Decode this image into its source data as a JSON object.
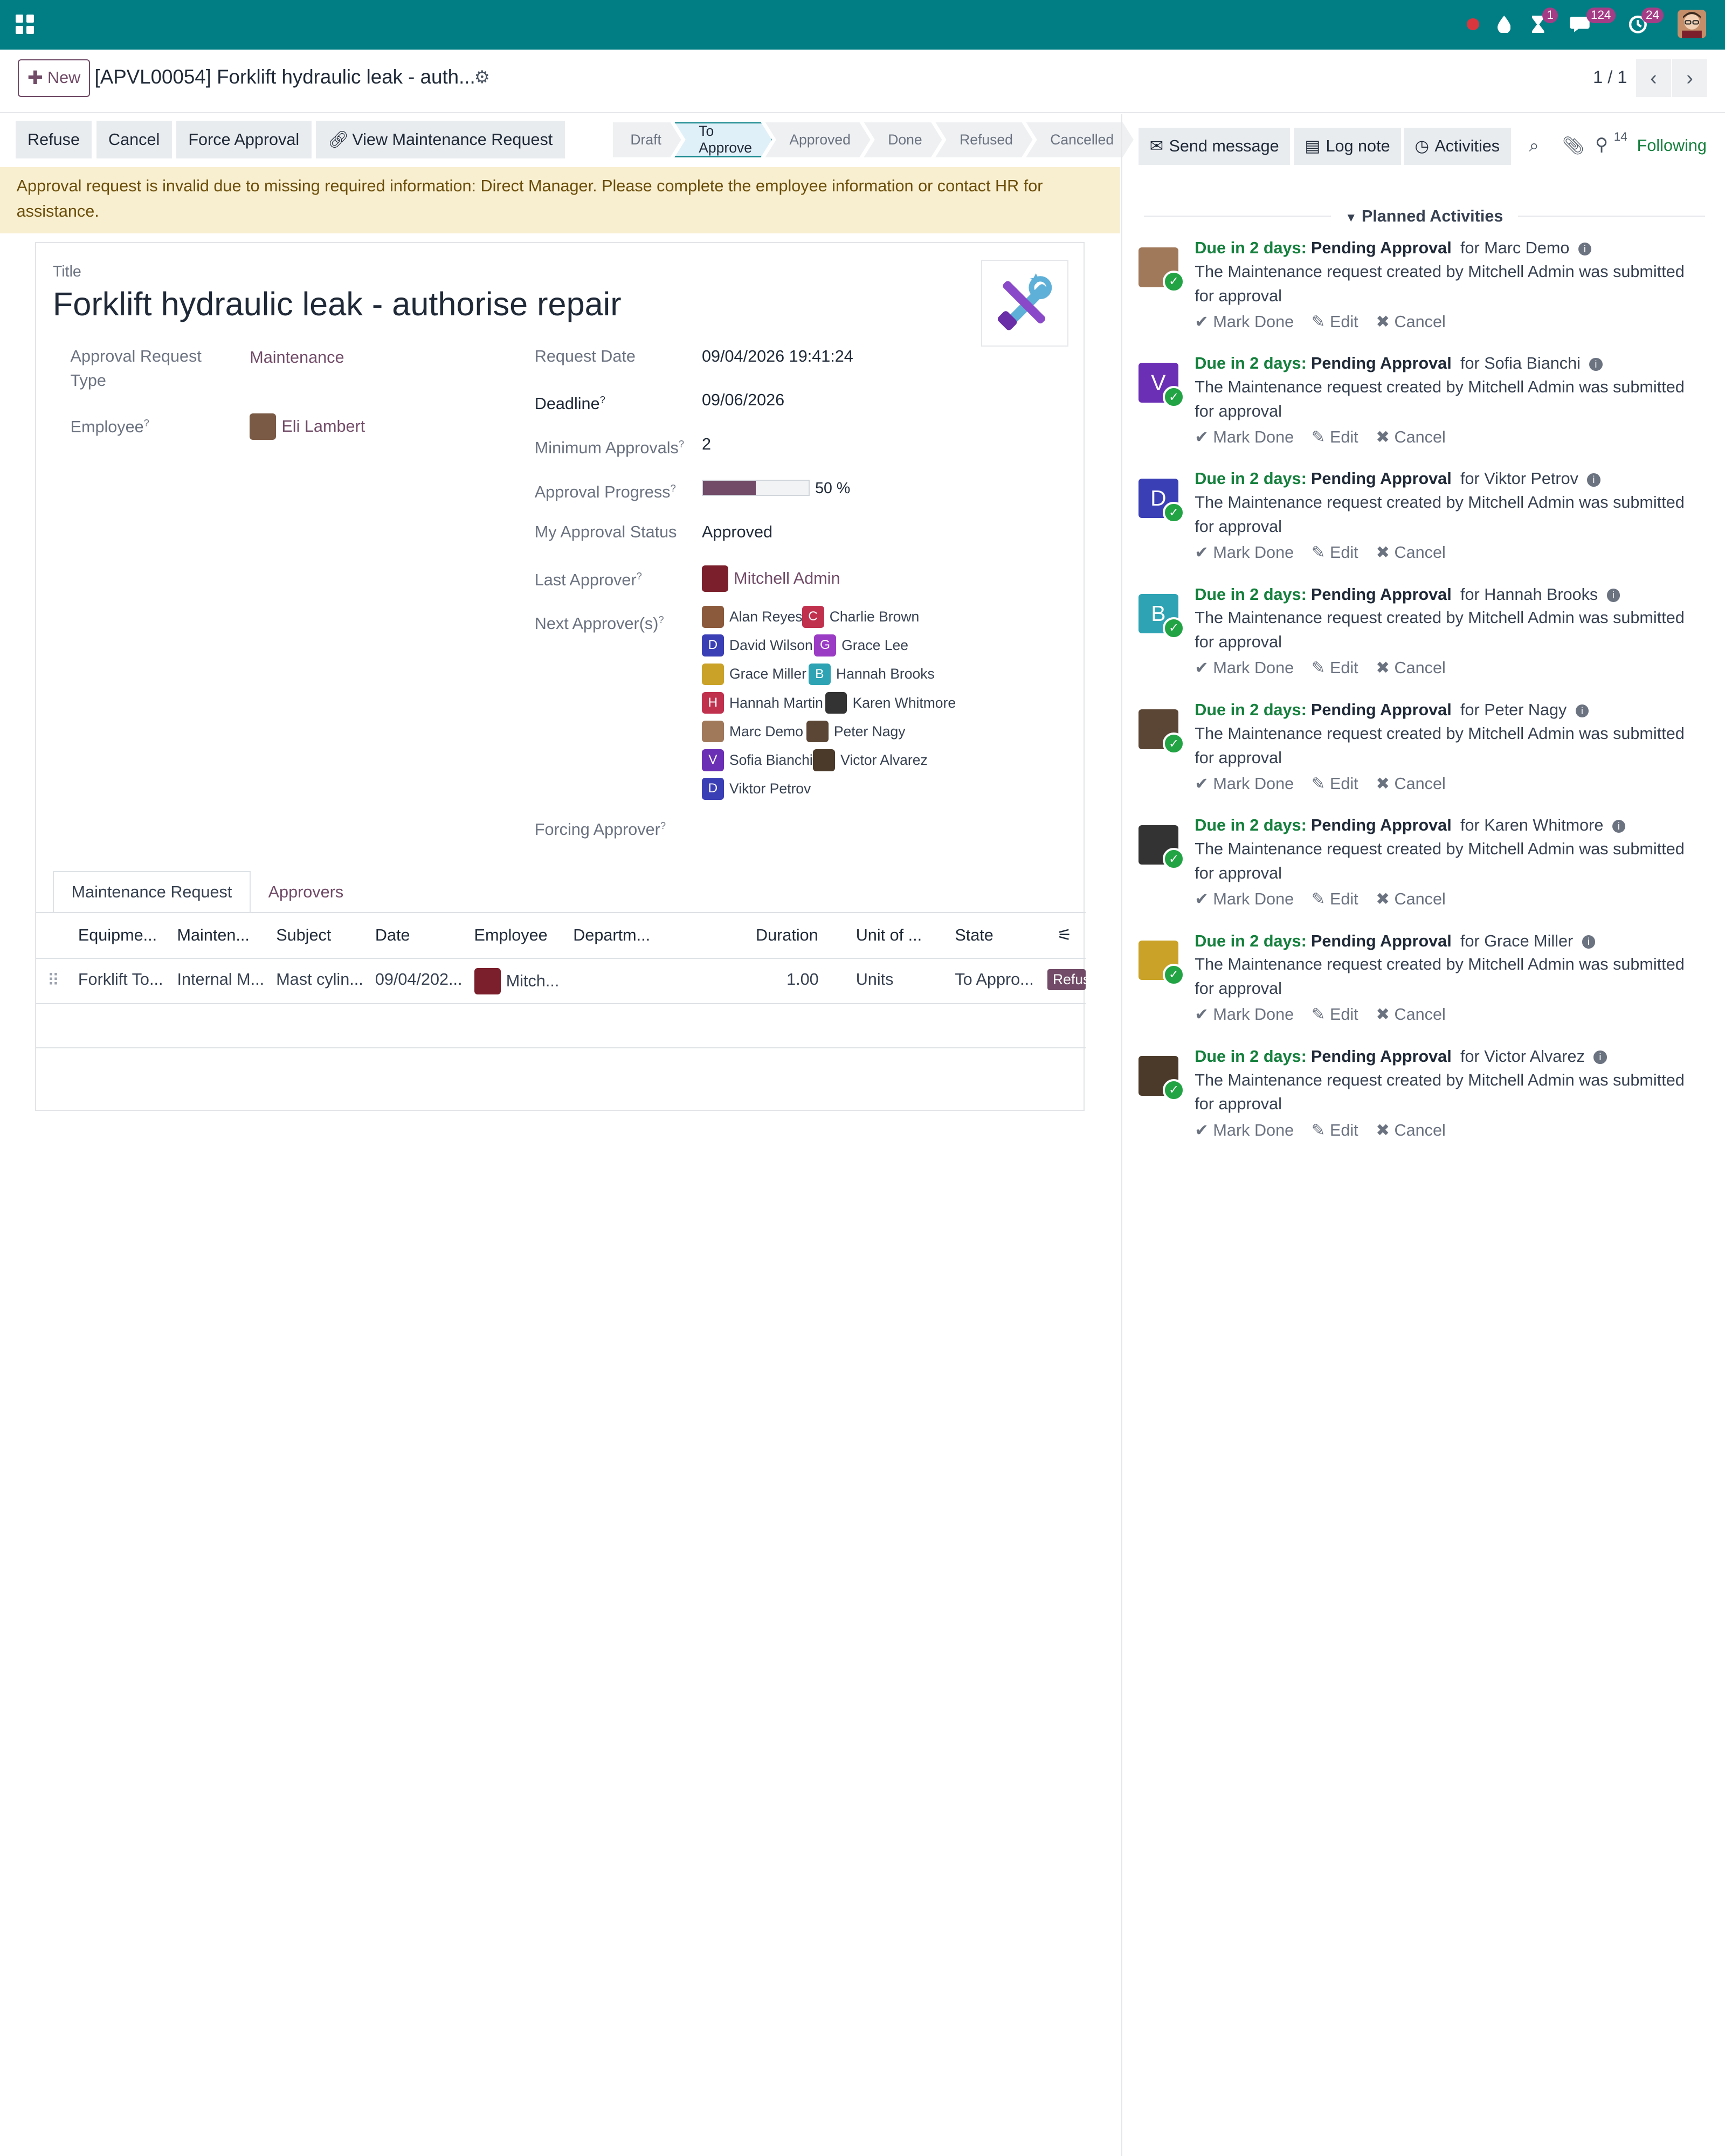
{
  "topbar": {
    "notif_activity_count": "1",
    "notif_messages_count": "124",
    "notif_updates_count": "24"
  },
  "control": {
    "new_label": "New",
    "record_title": "[APVL00054] Forklift hydraulic leak - auth...",
    "pager": "1 / 1"
  },
  "statusbar": {
    "buttons": [
      "Refuse",
      "Cancel",
      "Force Approval",
      "View Maintenance Request"
    ],
    "stages": [
      "Draft",
      "To Approve",
      "Approved",
      "Done",
      "Refused",
      "Cancelled"
    ],
    "active_stage": "To Approve"
  },
  "alert": "Approval request is invalid due to missing required information: Direct Manager. Please complete the employee information or contact HR for assistance.",
  "form": {
    "title_label": "Title",
    "title": "Forklift hydraulic leak - authorise repair",
    "approval_type_label": "Approval Request Type",
    "approval_type": "Maintenance",
    "employee_label": "Employee",
    "employee": "Eli Lambert",
    "request_date_label": "Request Date",
    "request_date": "09/04/2026 19:41:24",
    "deadline_label": "Deadline",
    "deadline": "09/06/2026",
    "min_approvals_label": "Minimum Approvals",
    "min_approvals": "2",
    "progress_label": "Approval Progress",
    "progress_value": 50,
    "progress_text": "50 %",
    "my_status_label": "My Approval Status",
    "my_status": "Approved",
    "last_approver_label": "Last Approver",
    "last_approver": "Mitchell Admin",
    "next_approvers_label": "Next Approver(s)",
    "next_approvers": [
      {
        "name": "Alan Reyes",
        "initial": "",
        "color": "#8b5a3c"
      },
      {
        "name": "Charlie Brown",
        "initial": "C",
        "color": "#c0314e"
      },
      {
        "name": "David Wilson",
        "initial": "D",
        "color": "#3b3fb5"
      },
      {
        "name": "Grace Lee",
        "initial": "G",
        "color": "#9b3cc5"
      },
      {
        "name": "Grace Miller",
        "initial": "",
        "color": "#c9a227"
      },
      {
        "name": "Hannah Brooks",
        "initial": "B",
        "color": "#2ea3b3"
      },
      {
        "name": "Hannah Martin",
        "initial": "H",
        "color": "#c0314e"
      },
      {
        "name": "Karen Whitmore",
        "initial": "",
        "color": "#333333"
      },
      {
        "name": "Marc Demo",
        "initial": "",
        "color": "#a0785a"
      },
      {
        "name": "Peter Nagy",
        "initial": "",
        "color": "#5b4636"
      },
      {
        "name": "Sofia Bianchi",
        "initial": "V",
        "color": "#6b2fb5"
      },
      {
        "name": "Victor Alvarez",
        "initial": "",
        "color": "#4b3a2a"
      },
      {
        "name": "Viktor Petrov",
        "initial": "D",
        "color": "#3b3fb5"
      }
    ],
    "forcing_approver_label": "Forcing Approver"
  },
  "tabs": [
    "Maintenance Request",
    "Approvers"
  ],
  "table": {
    "headers": [
      "Equipme...",
      "Mainten...",
      "Subject",
      "Date",
      "Employee",
      "Departm...",
      "Duration",
      "Unit of ...",
      "State"
    ],
    "row": [
      "Forklift To...",
      "Internal M...",
      "Mast cylin...",
      "09/04/202...",
      "Mitch...",
      "",
      "1.00",
      "Units",
      "To Appro..."
    ],
    "row_button": "Refuse"
  },
  "chatter": {
    "send_message": "Send message",
    "log_note": "Log note",
    "activities": "Activities",
    "followers_count": "14",
    "following": "Following",
    "planned_title": "Planned Activities",
    "activities_list": [
      {
        "due": "Due in 2 days:",
        "type": "Pending Approval",
        "for": "for Marc Demo",
        "initial": "",
        "color": "#a0785a"
      },
      {
        "due": "Due in 2 days:",
        "type": "Pending Approval",
        "for": "for Sofia Bianchi",
        "initial": "V",
        "color": "#6b2fb5"
      },
      {
        "due": "Due in 2 days:",
        "type": "Pending Approval",
        "for": "for Viktor Petrov",
        "initial": "D",
        "color": "#3b3fb5"
      },
      {
        "due": "Due in 2 days:",
        "type": "Pending Approval",
        "for": "for Hannah Brooks",
        "initial": "B",
        "color": "#2ea3b3"
      },
      {
        "due": "Due in 2 days:",
        "type": "Pending Approval",
        "for": "for Peter Nagy",
        "initial": "",
        "color": "#5b4636"
      },
      {
        "due": "Due in 2 days:",
        "type": "Pending Approval",
        "for": "for Karen Whitmore",
        "initial": "",
        "color": "#333333"
      },
      {
        "due": "Due in 2 days:",
        "type": "Pending Approval",
        "for": "for Grace Miller",
        "initial": "",
        "color": "#c9a227"
      },
      {
        "due": "Due in 2 days:",
        "type": "Pending Approval",
        "for": "for Victor Alvarez",
        "initial": "",
        "color": "#4b3a2a"
      }
    ],
    "activity_body": "The Maintenance request created by Mitchell Admin was submitted for approval",
    "mark_done": "Mark Done",
    "edit": "Edit",
    "cancel": "Cancel"
  }
}
